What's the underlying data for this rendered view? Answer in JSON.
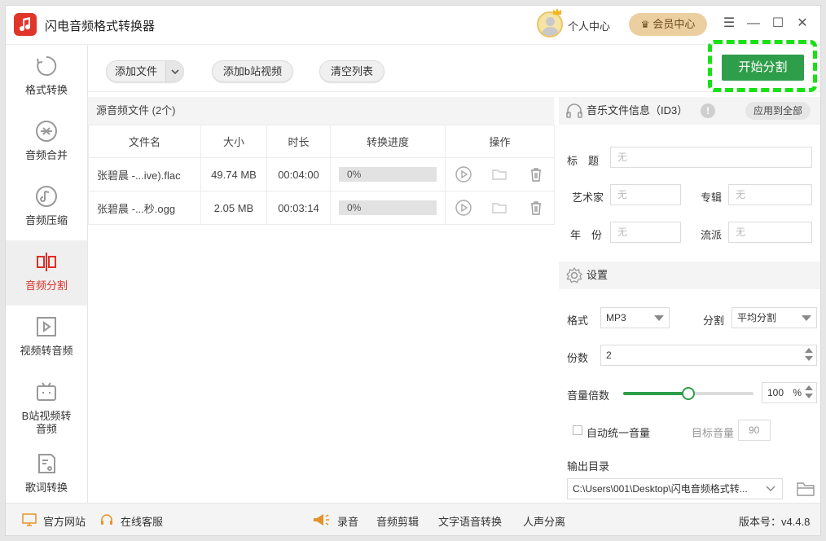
{
  "app": {
    "title": "闪电音频格式转换器",
    "version": "版本号：v4.4.8"
  },
  "header": {
    "personal_center": "个人中心",
    "vip_center": "会员中心"
  },
  "sidebar": {
    "items": [
      {
        "label": "格式转换"
      },
      {
        "label": "音频合并"
      },
      {
        "label": "音频压缩"
      },
      {
        "label": "音频分割",
        "active": true
      },
      {
        "label": "视频转音频"
      },
      {
        "label": "B站视频转\n音频"
      },
      {
        "label": "歌词转换"
      }
    ]
  },
  "toolbar": {
    "add_file": "添加文件",
    "add_bilibili": "添加b站视频",
    "clear_list": "清空列表",
    "start": "开始分割"
  },
  "files": {
    "header": "源音频文件 (2个)",
    "columns": [
      "文件名",
      "大小",
      "时长",
      "转换进度",
      "操作"
    ],
    "rows": [
      {
        "name": "张碧晨 -...ive).flac",
        "size": "49.74 MB",
        "duration": "00:04:00",
        "progress": "0%"
      },
      {
        "name": "张碧晨 -...秒.ogg",
        "size": "2.05 MB",
        "duration": "00:03:14",
        "progress": "0%"
      }
    ]
  },
  "music_info": {
    "header": "音乐文件信息（ID3）",
    "apply_all": "应用到全部",
    "title_label": "标　题",
    "artist_label": "艺术家",
    "album_label": "专辑",
    "year_label": "年　份",
    "genre_label": "流派",
    "empty_placeholder": "无"
  },
  "settings": {
    "header": "设置",
    "format_label": "格式",
    "format_value": "MP3",
    "split_label": "分割",
    "split_value": "平均分割",
    "parts_label": "份数",
    "parts_value": "2",
    "volume_label": "音量倍数",
    "volume_value": "100",
    "volume_unit": "%",
    "volume_fraction": 0.5,
    "auto_volume_label": "自动统一音量",
    "target_volume_label": "目标音量",
    "target_volume_value": "90",
    "output_label": "输出目录",
    "output_path": "C:\\Users\\001\\Desktop\\闪电音频格式转..."
  },
  "bottom": {
    "official_site": "官方网站",
    "online_service": "在线客服",
    "record": "录音",
    "audio_edit": "音频剪辑",
    "tts": "文字语音转换",
    "vocal_separation": "人声分离"
  },
  "colors": {
    "accent_green": "#2f9e4a",
    "brand_red": "#e0352b",
    "active_red": "#d9322a",
    "highlight": "#18e114"
  }
}
